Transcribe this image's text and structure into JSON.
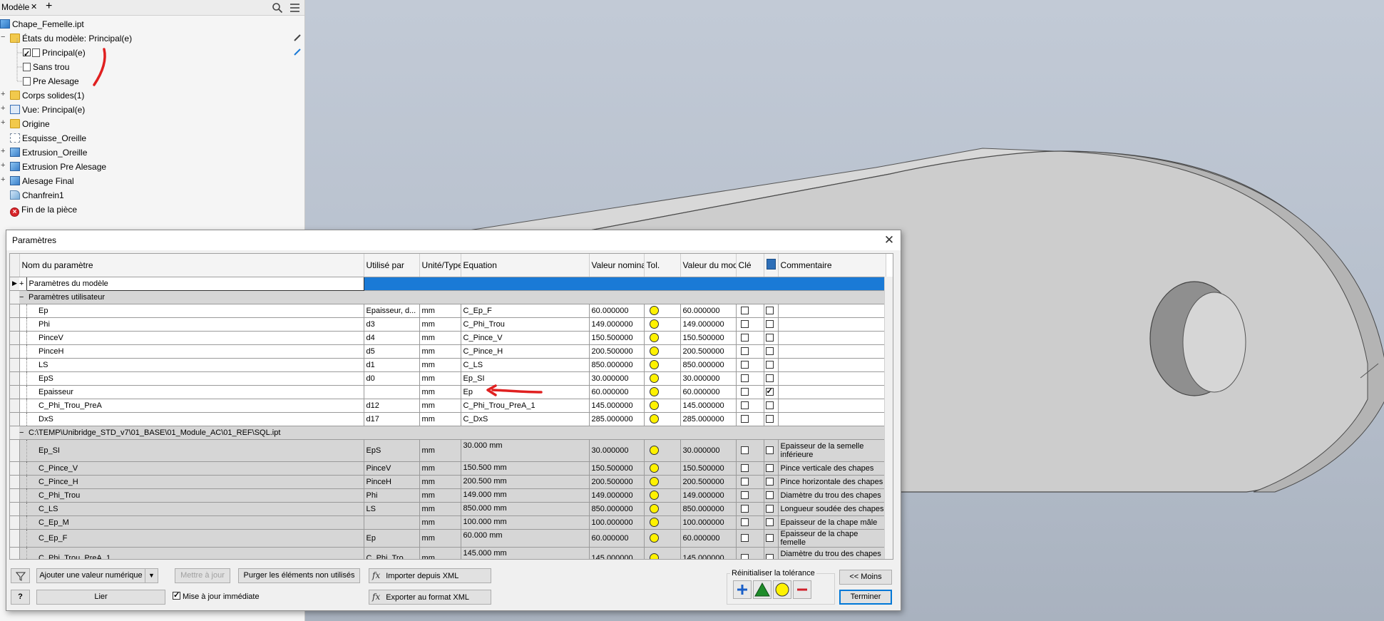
{
  "browser": {
    "tab_label": "Modèle",
    "tab_close": "✕",
    "tab_add": "+",
    "tree": [
      {
        "label": "Chape_Femelle.ipt",
        "icon": "part-icon",
        "level": 0
      },
      {
        "label": "États du modèle: Principal(e)",
        "icon": "folder-icon",
        "level": 1
      },
      {
        "label": "Principal(e)",
        "icon": "model-state-icon",
        "level": 2
      },
      {
        "label": "Sans trou",
        "icon": "model-state-icon",
        "level": 2
      },
      {
        "label": "Pre Alesage",
        "icon": "model-state-icon",
        "level": 2
      },
      {
        "label": "Corps solides(1)",
        "icon": "folder-icon",
        "level": 1
      },
      {
        "label": "Vue: Principal(e)",
        "icon": "view-icon",
        "level": 1
      },
      {
        "label": "Origine",
        "icon": "folder-icon",
        "level": 1
      },
      {
        "label": "Esquisse_Oreille",
        "icon": "sketch-icon",
        "level": 1
      },
      {
        "label": "Extrusion_Oreille",
        "icon": "extrusion-icon",
        "level": 1
      },
      {
        "label": "Extrusion Pre Alesage",
        "icon": "extrusion-icon",
        "level": 1
      },
      {
        "label": "Alesage Final",
        "icon": "extrusion-icon",
        "level": 1
      },
      {
        "label": "Chanfrein1",
        "icon": "chamfer-icon",
        "level": 1
      },
      {
        "label": "Fin de la pièce",
        "icon": "end-of-part-icon",
        "level": 1
      }
    ]
  },
  "dialog": {
    "title": "Paramètres",
    "columns": [
      "Nom du paramètre",
      "Utilisé par",
      "Unité/Type",
      "Equation",
      "Valeur nominale",
      "Tol.",
      "Valeur du modè",
      "Clé",
      "",
      "Commentaire"
    ],
    "groups": {
      "model_params": "Paramètres du modèle",
      "user_params": "Paramètres utilisateur",
      "linked_file": "C:\\TEMP\\Unibridge_STD_v7\\01_BASE\\01_Module_AC\\01_REF\\SQL.ipt"
    },
    "user_rows": [
      {
        "name": "Ep",
        "used_by": "Epaisseur, d...",
        "unit": "mm",
        "equation": "C_Ep_F",
        "nominal": "60.000000",
        "model": "60.000000",
        "key": false,
        "export": false,
        "comment": ""
      },
      {
        "name": "Phi",
        "used_by": "d3",
        "unit": "mm",
        "equation": "C_Phi_Trou",
        "nominal": "149.000000",
        "model": "149.000000",
        "key": false,
        "export": false,
        "comment": ""
      },
      {
        "name": "PinceV",
        "used_by": "d4",
        "unit": "mm",
        "equation": "C_Pince_V",
        "nominal": "150.500000",
        "model": "150.500000",
        "key": false,
        "export": false,
        "comment": ""
      },
      {
        "name": "PinceH",
        "used_by": "d5",
        "unit": "mm",
        "equation": "C_Pince_H",
        "nominal": "200.500000",
        "model": "200.500000",
        "key": false,
        "export": false,
        "comment": ""
      },
      {
        "name": "LS",
        "used_by": "d1",
        "unit": "mm",
        "equation": "C_LS",
        "nominal": "850.000000",
        "model": "850.000000",
        "key": false,
        "export": false,
        "comment": ""
      },
      {
        "name": "EpS",
        "used_by": "d0",
        "unit": "mm",
        "equation": "Ep_SI",
        "nominal": "30.000000",
        "model": "30.000000",
        "key": false,
        "export": false,
        "comment": ""
      },
      {
        "name": "Epaisseur",
        "used_by": "",
        "unit": "mm",
        "equation": "Ep",
        "nominal": "60.000000",
        "model": "60.000000",
        "key": false,
        "export": true,
        "comment": ""
      },
      {
        "name": "C_Phi_Trou_PreA",
        "used_by": "d12",
        "unit": "mm",
        "equation": "C_Phi_Trou_PreA_1",
        "nominal": "145.000000",
        "model": "145.000000",
        "key": false,
        "export": false,
        "comment": ""
      },
      {
        "name": "DxS",
        "used_by": "d17",
        "unit": "mm",
        "equation": "C_DxS",
        "nominal": "285.000000",
        "model": "285.000000",
        "key": false,
        "export": false,
        "comment": ""
      }
    ],
    "linked_rows": [
      {
        "name": "Ep_SI",
        "used_by": "EpS",
        "unit": "mm",
        "equation": "30.000 mm",
        "nominal": "30.000000",
        "model": "30.000000",
        "comment": "Epaisseur de la semelle inférieure",
        "tall": true
      },
      {
        "name": "C_Pince_V",
        "used_by": "PinceV",
        "unit": "mm",
        "equation": "150.500 mm",
        "nominal": "150.500000",
        "model": "150.500000",
        "comment": "Pince verticale des chapes",
        "tall": false
      },
      {
        "name": "C_Pince_H",
        "used_by": "PinceH",
        "unit": "mm",
        "equation": "200.500 mm",
        "nominal": "200.500000",
        "model": "200.500000",
        "comment": "Pince horizontale des chapes",
        "tall": false
      },
      {
        "name": "C_Phi_Trou",
        "used_by": "Phi",
        "unit": "mm",
        "equation": "149.000 mm",
        "nominal": "149.000000",
        "model": "149.000000",
        "comment": "Diamètre du trou des chapes",
        "tall": false
      },
      {
        "name": "C_LS",
        "used_by": "LS",
        "unit": "mm",
        "equation": "850.000 mm",
        "nominal": "850.000000",
        "model": "850.000000",
        "comment": "Longueur soudée des chapes",
        "tall": false
      },
      {
        "name": "C_Ep_M",
        "used_by": "",
        "unit": "mm",
        "equation": "100.000 mm",
        "nominal": "100.000000",
        "model": "100.000000",
        "comment": "Epaisseur de la chape mâle",
        "tall": false
      },
      {
        "name": "C_Ep_F",
        "used_by": "Ep",
        "unit": "mm",
        "equation": "60.000 mm",
        "nominal": "60.000000",
        "model": "60.000000",
        "comment": "Epaisseur de la chape femelle",
        "tall": false
      },
      {
        "name": "C_Phi_Trou_PreA_1",
        "used_by": "C_Phi_Tro...",
        "unit": "mm",
        "equation": "145.000 mm",
        "nominal": "145.000000",
        "model": "145.000000",
        "comment": "Diamètre du trou des chapes avant alésage",
        "tall": true
      }
    ],
    "footer": {
      "add_numeric": "Ajouter une valeur numérique",
      "update": "Mettre à jour",
      "purge": "Purger les éléments non utilisés",
      "import_xml": "Importer depuis XML",
      "link": "Lier",
      "immediate_update": "Mise à jour immédiate",
      "immediate_checked": true,
      "export_xml": "Exporter au format XML",
      "reset_tol_label": "Réinitialiser la tolérance",
      "less": "<< Moins",
      "finish": "Terminer",
      "help": "?"
    }
  },
  "colors": {
    "selection_blue": "#1a7ad6",
    "tol_yellow": "#fff200",
    "annotation_red": "#e02020",
    "viewport_bg": "#b9c1cc",
    "part_grey": "#cfcfcf"
  }
}
